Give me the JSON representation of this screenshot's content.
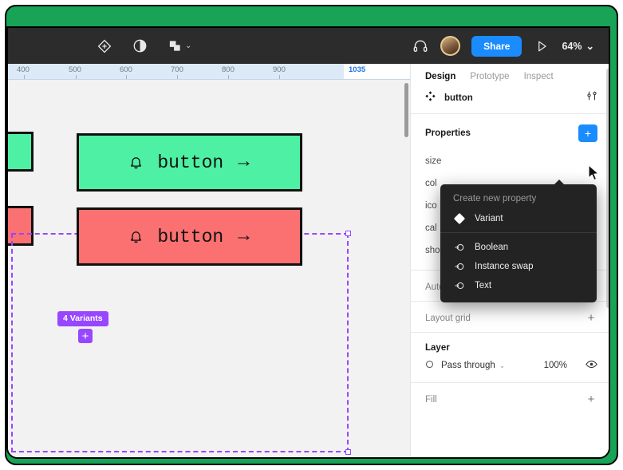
{
  "window": {
    "background_color": "#18a356",
    "surface_color": "#f2f2f2"
  },
  "toolbar": {
    "icons": [
      {
        "name": "move-tool-icon",
        "label": "Move"
      },
      {
        "name": "mask-contrast-icon",
        "label": "Mask"
      },
      {
        "name": "components-shapes-icon",
        "label": "Shapes"
      }
    ],
    "shapes_chevron": "⌄",
    "headphones_icon": "headphones-icon",
    "avatar_alt": "User avatar",
    "share_label": "Share",
    "present_icon": "play-present-icon",
    "zoom_level": "64%",
    "zoom_chevron": "⌄"
  },
  "canvas": {
    "ruler": {
      "ticks": [
        "400",
        "500",
        "600",
        "700",
        "800",
        "900"
      ],
      "selection_value": "1035",
      "selection_color": "#1a73e8"
    },
    "selection": {
      "color": "#9747ff",
      "style": "dashed"
    },
    "buttons": [
      {
        "label": "button",
        "fill": "#4ef0a4",
        "stroke": "#111111",
        "leading_icon": "bell-icon",
        "trailing_icon": "arrow-right-icon",
        "arrow": "→"
      },
      {
        "label": "button",
        "fill": "#fb7070",
        "stroke": "#111111",
        "leading_icon": "bell-icon",
        "trailing_icon": "arrow-right-icon",
        "arrow": "→"
      }
    ],
    "variants_badge": "4 Variants",
    "variants_add": "+",
    "badge_color": "#9747ff"
  },
  "panel": {
    "tabs": [
      {
        "label": "Design",
        "active": true
      },
      {
        "label": "Prototype",
        "active": false
      },
      {
        "label": "Inspect",
        "active": false
      }
    ],
    "component": {
      "icon": "component-icon",
      "name": "button",
      "settings_icon": "sliders-icon"
    },
    "properties": {
      "title": "Properties",
      "add_label": "+",
      "add_color": "#1a8cff",
      "items": [
        "size",
        "col",
        "ico",
        "cal",
        "sho"
      ]
    },
    "auto_layout": {
      "title": "Auto layout",
      "add_label": "+"
    },
    "layout_grid": {
      "title": "Layout grid",
      "add_label": "+"
    },
    "layer": {
      "title": "Layer",
      "blend_mode": "Pass through",
      "blend_chevron": "⌄",
      "opacity": "100%",
      "visibility_icon": "eye-icon"
    },
    "fill": {
      "title": "Fill",
      "add_label": "+"
    }
  },
  "dropdown": {
    "header": "Create new property",
    "primary": {
      "label": "Variant",
      "icon": "diamond-icon"
    },
    "items": [
      {
        "label": "Boolean",
        "icon": "property-swap-icon"
      },
      {
        "label": "Instance swap",
        "icon": "property-swap-icon"
      },
      {
        "label": "Text",
        "icon": "property-swap-icon"
      }
    ]
  }
}
